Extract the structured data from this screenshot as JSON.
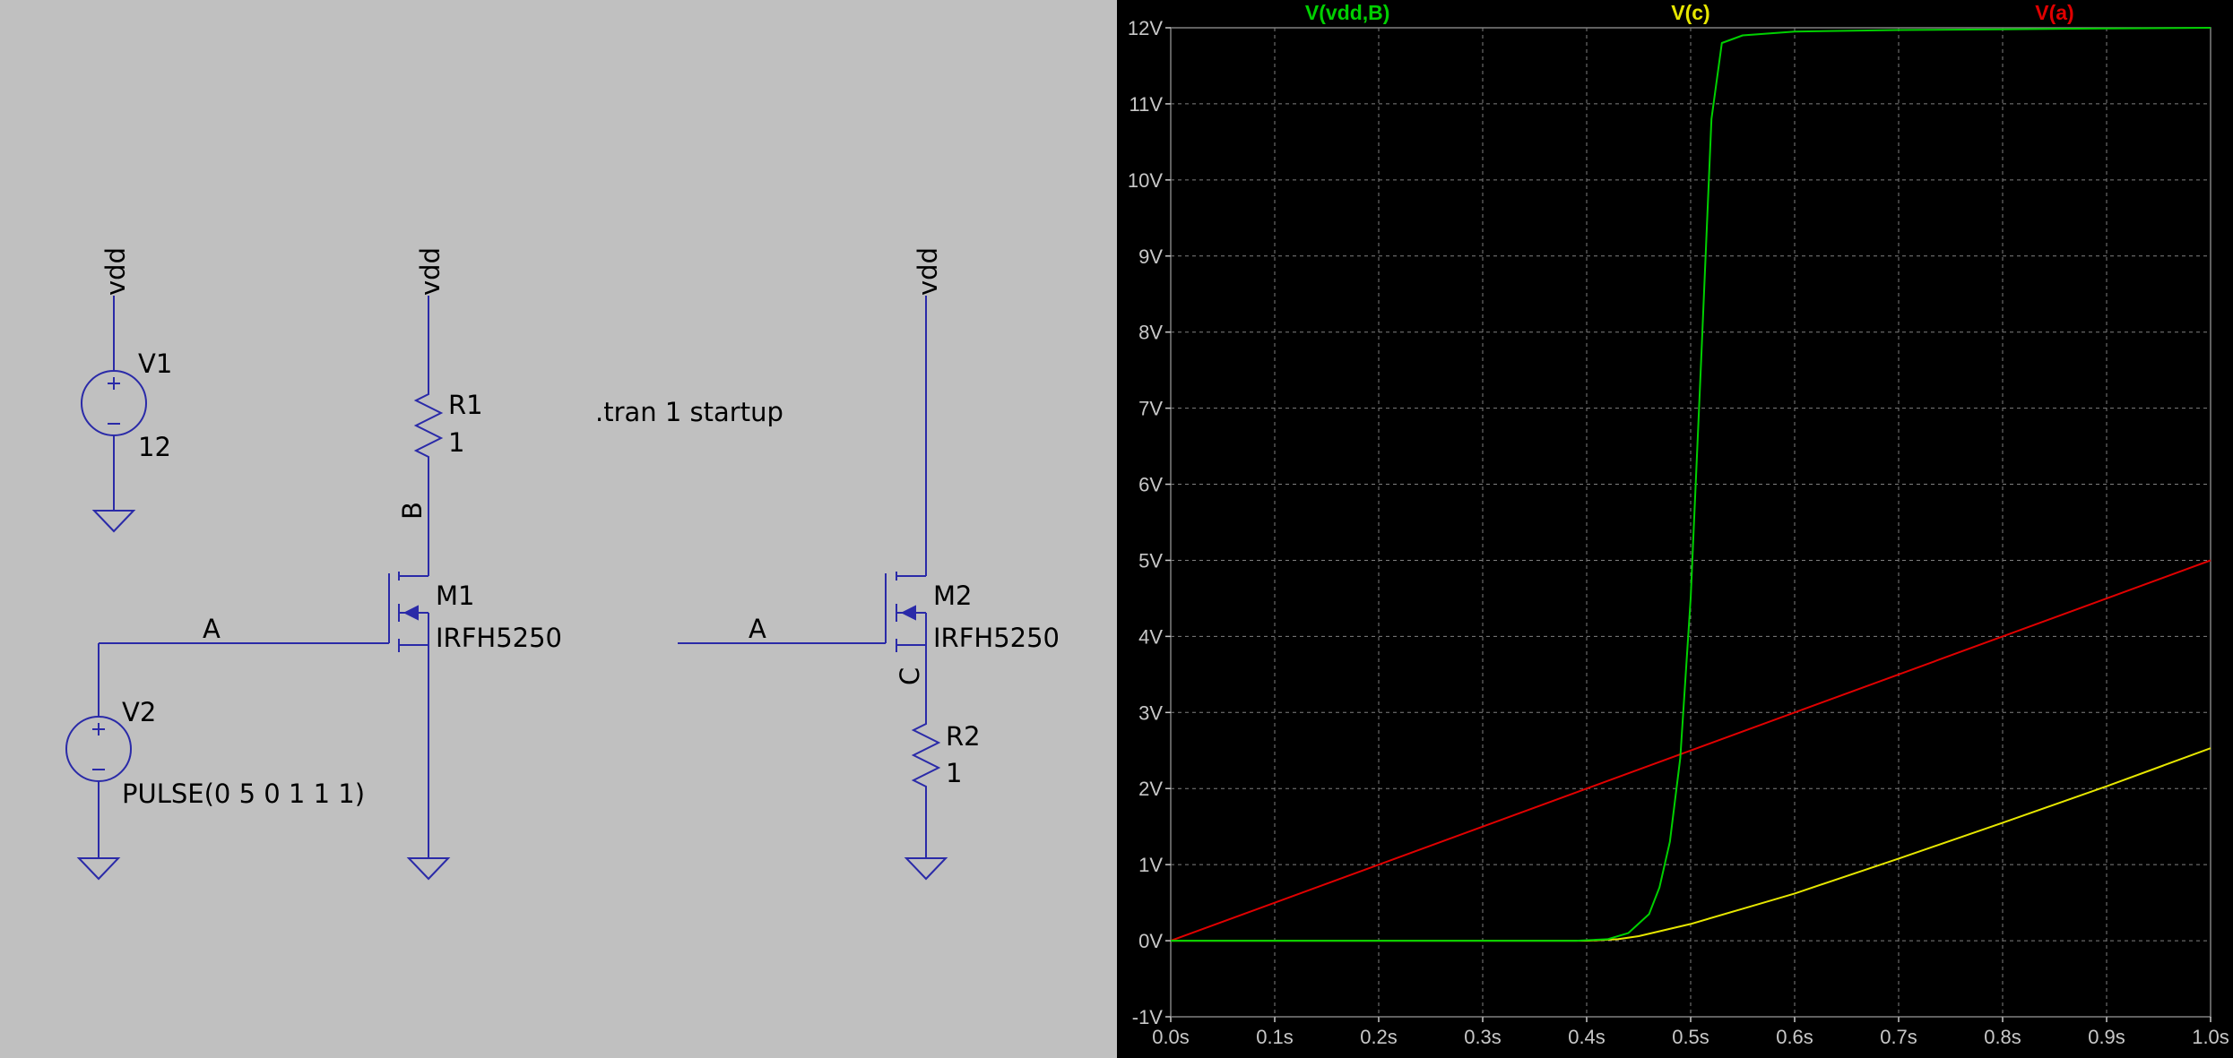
{
  "schematic": {
    "wire_color": "#2a2aa8",
    "labels": {
      "v1_net": "vdd",
      "r1_net": "vdd",
      "m2_net": "vdd",
      "v1_name": "V1",
      "v1_value": "12",
      "r1_name": "R1",
      "r1_value": "1",
      "node_b": "B",
      "m1_name": "M1",
      "m1_model": "IRFH5250",
      "node_a_left": "A",
      "node_a_right": "A",
      "m2_name": "M2",
      "m2_model": "IRFH5250",
      "node_c": "C",
      "r2_name": "R2",
      "r2_value": "1",
      "v2_name": "V2",
      "v2_value": "PULSE(0 5 0 1 1 1)",
      "directive": ".tran 1 startup"
    }
  },
  "chart_data": {
    "type": "line",
    "title": "",
    "xlabel": "",
    "ylabel": "",
    "xlim": [
      0,
      1
    ],
    "ylim": [
      -1,
      12
    ],
    "grid": true,
    "background": "#000000",
    "grid_color": "#808080",
    "x_ticks": [
      0,
      0.1,
      0.2,
      0.3,
      0.4,
      0.5,
      0.6,
      0.7,
      0.8,
      0.9,
      1.0
    ],
    "x_tick_labels": [
      "0.0s",
      "0.1s",
      "0.2s",
      "0.3s",
      "0.4s",
      "0.5s",
      "0.6s",
      "0.7s",
      "0.8s",
      "0.9s",
      "1.0s"
    ],
    "y_ticks": [
      12,
      11,
      10,
      9,
      8,
      7,
      6,
      5,
      4,
      3,
      2,
      1,
      0,
      -1
    ],
    "y_tick_labels": [
      "12V",
      "11V",
      "10V",
      "9V",
      "8V",
      "7V",
      "6V",
      "5V",
      "4V",
      "3V",
      "2V",
      "1V",
      "0V",
      "-1V"
    ],
    "series": [
      {
        "name": "V(vdd,B)",
        "color": "#00d000",
        "x": [
          0,
          0.39,
          0.42,
          0.44,
          0.46,
          0.47,
          0.48,
          0.49,
          0.5,
          0.51,
          0.52,
          0.53,
          0.55,
          0.6,
          0.7,
          0.8,
          0.9,
          1.0
        ],
        "y": [
          0,
          0,
          0.02,
          0.1,
          0.35,
          0.7,
          1.3,
          2.4,
          4.5,
          7.6,
          10.8,
          11.8,
          11.9,
          11.95,
          11.97,
          11.98,
          11.99,
          12.0
        ]
      },
      {
        "name": "V(c)",
        "color": "#e6e600",
        "x": [
          0,
          0.4,
          0.43,
          0.45,
          0.5,
          0.55,
          0.6,
          0.7,
          0.8,
          0.9,
          1.0
        ],
        "y": [
          0,
          0,
          0.02,
          0.06,
          0.22,
          0.42,
          0.62,
          1.08,
          1.55,
          2.03,
          2.53
        ]
      },
      {
        "name": "V(a)",
        "color": "#e00000",
        "x": [
          0,
          1.0
        ],
        "y": [
          0,
          5
        ]
      }
    ]
  }
}
